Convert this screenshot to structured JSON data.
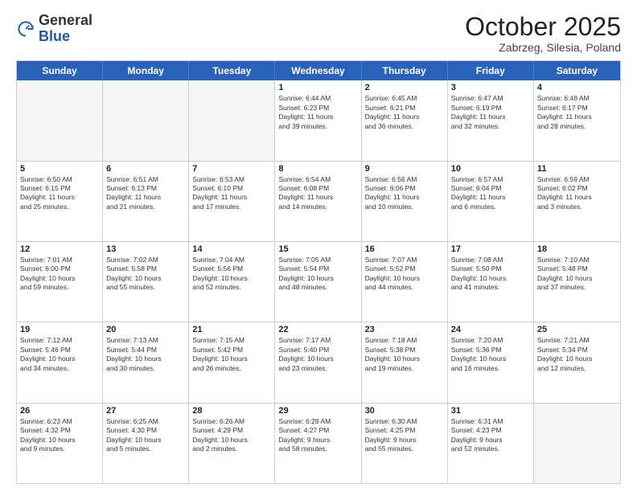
{
  "logo": {
    "general": "General",
    "blue": "Blue"
  },
  "header": {
    "month": "October 2025",
    "location": "Zabrzeg, Silesia, Poland"
  },
  "weekdays": [
    "Sunday",
    "Monday",
    "Tuesday",
    "Wednesday",
    "Thursday",
    "Friday",
    "Saturday"
  ],
  "rows": [
    [
      {
        "day": "",
        "empty": true,
        "lines": []
      },
      {
        "day": "",
        "empty": true,
        "lines": []
      },
      {
        "day": "",
        "empty": true,
        "lines": []
      },
      {
        "day": "1",
        "empty": false,
        "lines": [
          "Sunrise: 6:44 AM",
          "Sunset: 6:23 PM",
          "Daylight: 11 hours",
          "and 39 minutes."
        ]
      },
      {
        "day": "2",
        "empty": false,
        "lines": [
          "Sunrise: 6:45 AM",
          "Sunset: 6:21 PM",
          "Daylight: 11 hours",
          "and 36 minutes."
        ]
      },
      {
        "day": "3",
        "empty": false,
        "lines": [
          "Sunrise: 6:47 AM",
          "Sunset: 6:19 PM",
          "Daylight: 11 hours",
          "and 32 minutes."
        ]
      },
      {
        "day": "4",
        "empty": false,
        "lines": [
          "Sunrise: 6:48 AM",
          "Sunset: 6:17 PM",
          "Daylight: 11 hours",
          "and 28 minutes."
        ]
      }
    ],
    [
      {
        "day": "5",
        "empty": false,
        "lines": [
          "Sunrise: 6:50 AM",
          "Sunset: 6:15 PM",
          "Daylight: 11 hours",
          "and 25 minutes."
        ]
      },
      {
        "day": "6",
        "empty": false,
        "lines": [
          "Sunrise: 6:51 AM",
          "Sunset: 6:13 PM",
          "Daylight: 11 hours",
          "and 21 minutes."
        ]
      },
      {
        "day": "7",
        "empty": false,
        "lines": [
          "Sunrise: 6:53 AM",
          "Sunset: 6:10 PM",
          "Daylight: 11 hours",
          "and 17 minutes."
        ]
      },
      {
        "day": "8",
        "empty": false,
        "lines": [
          "Sunrise: 6:54 AM",
          "Sunset: 6:08 PM",
          "Daylight: 11 hours",
          "and 14 minutes."
        ]
      },
      {
        "day": "9",
        "empty": false,
        "lines": [
          "Sunrise: 6:56 AM",
          "Sunset: 6:06 PM",
          "Daylight: 11 hours",
          "and 10 minutes."
        ]
      },
      {
        "day": "10",
        "empty": false,
        "lines": [
          "Sunrise: 6:57 AM",
          "Sunset: 6:04 PM",
          "Daylight: 11 hours",
          "and 6 minutes."
        ]
      },
      {
        "day": "11",
        "empty": false,
        "lines": [
          "Sunrise: 6:59 AM",
          "Sunset: 6:02 PM",
          "Daylight: 11 hours",
          "and 3 minutes."
        ]
      }
    ],
    [
      {
        "day": "12",
        "empty": false,
        "lines": [
          "Sunrise: 7:01 AM",
          "Sunset: 6:00 PM",
          "Daylight: 10 hours",
          "and 59 minutes."
        ]
      },
      {
        "day": "13",
        "empty": false,
        "lines": [
          "Sunrise: 7:02 AM",
          "Sunset: 5:58 PM",
          "Daylight: 10 hours",
          "and 55 minutes."
        ]
      },
      {
        "day": "14",
        "empty": false,
        "lines": [
          "Sunrise: 7:04 AM",
          "Sunset: 5:56 PM",
          "Daylight: 10 hours",
          "and 52 minutes."
        ]
      },
      {
        "day": "15",
        "empty": false,
        "lines": [
          "Sunrise: 7:05 AM",
          "Sunset: 5:54 PM",
          "Daylight: 10 hours",
          "and 48 minutes."
        ]
      },
      {
        "day": "16",
        "empty": false,
        "lines": [
          "Sunrise: 7:07 AM",
          "Sunset: 5:52 PM",
          "Daylight: 10 hours",
          "and 44 minutes."
        ]
      },
      {
        "day": "17",
        "empty": false,
        "lines": [
          "Sunrise: 7:08 AM",
          "Sunset: 5:50 PM",
          "Daylight: 10 hours",
          "and 41 minutes."
        ]
      },
      {
        "day": "18",
        "empty": false,
        "lines": [
          "Sunrise: 7:10 AM",
          "Sunset: 5:48 PM",
          "Daylight: 10 hours",
          "and 37 minutes."
        ]
      }
    ],
    [
      {
        "day": "19",
        "empty": false,
        "lines": [
          "Sunrise: 7:12 AM",
          "Sunset: 5:46 PM",
          "Daylight: 10 hours",
          "and 34 minutes."
        ]
      },
      {
        "day": "20",
        "empty": false,
        "lines": [
          "Sunrise: 7:13 AM",
          "Sunset: 5:44 PM",
          "Daylight: 10 hours",
          "and 30 minutes."
        ]
      },
      {
        "day": "21",
        "empty": false,
        "lines": [
          "Sunrise: 7:15 AM",
          "Sunset: 5:42 PM",
          "Daylight: 10 hours",
          "and 26 minutes."
        ]
      },
      {
        "day": "22",
        "empty": false,
        "lines": [
          "Sunrise: 7:17 AM",
          "Sunset: 5:40 PM",
          "Daylight: 10 hours",
          "and 23 minutes."
        ]
      },
      {
        "day": "23",
        "empty": false,
        "lines": [
          "Sunrise: 7:18 AM",
          "Sunset: 5:38 PM",
          "Daylight: 10 hours",
          "and 19 minutes."
        ]
      },
      {
        "day": "24",
        "empty": false,
        "lines": [
          "Sunrise: 7:20 AM",
          "Sunset: 5:36 PM",
          "Daylight: 10 hours",
          "and 16 minutes."
        ]
      },
      {
        "day": "25",
        "empty": false,
        "lines": [
          "Sunrise: 7:21 AM",
          "Sunset: 5:34 PM",
          "Daylight: 10 hours",
          "and 12 minutes."
        ]
      }
    ],
    [
      {
        "day": "26",
        "empty": false,
        "lines": [
          "Sunrise: 6:23 AM",
          "Sunset: 4:32 PM",
          "Daylight: 10 hours",
          "and 9 minutes."
        ]
      },
      {
        "day": "27",
        "empty": false,
        "lines": [
          "Sunrise: 6:25 AM",
          "Sunset: 4:30 PM",
          "Daylight: 10 hours",
          "and 5 minutes."
        ]
      },
      {
        "day": "28",
        "empty": false,
        "lines": [
          "Sunrise: 6:26 AM",
          "Sunset: 4:29 PM",
          "Daylight: 10 hours",
          "and 2 minutes."
        ]
      },
      {
        "day": "29",
        "empty": false,
        "lines": [
          "Sunrise: 6:28 AM",
          "Sunset: 4:27 PM",
          "Daylight: 9 hours",
          "and 58 minutes."
        ]
      },
      {
        "day": "30",
        "empty": false,
        "lines": [
          "Sunrise: 6:30 AM",
          "Sunset: 4:25 PM",
          "Daylight: 9 hours",
          "and 55 minutes."
        ]
      },
      {
        "day": "31",
        "empty": false,
        "lines": [
          "Sunrise: 6:31 AM",
          "Sunset: 4:23 PM",
          "Daylight: 9 hours",
          "and 52 minutes."
        ]
      },
      {
        "day": "",
        "empty": true,
        "lines": []
      }
    ]
  ]
}
